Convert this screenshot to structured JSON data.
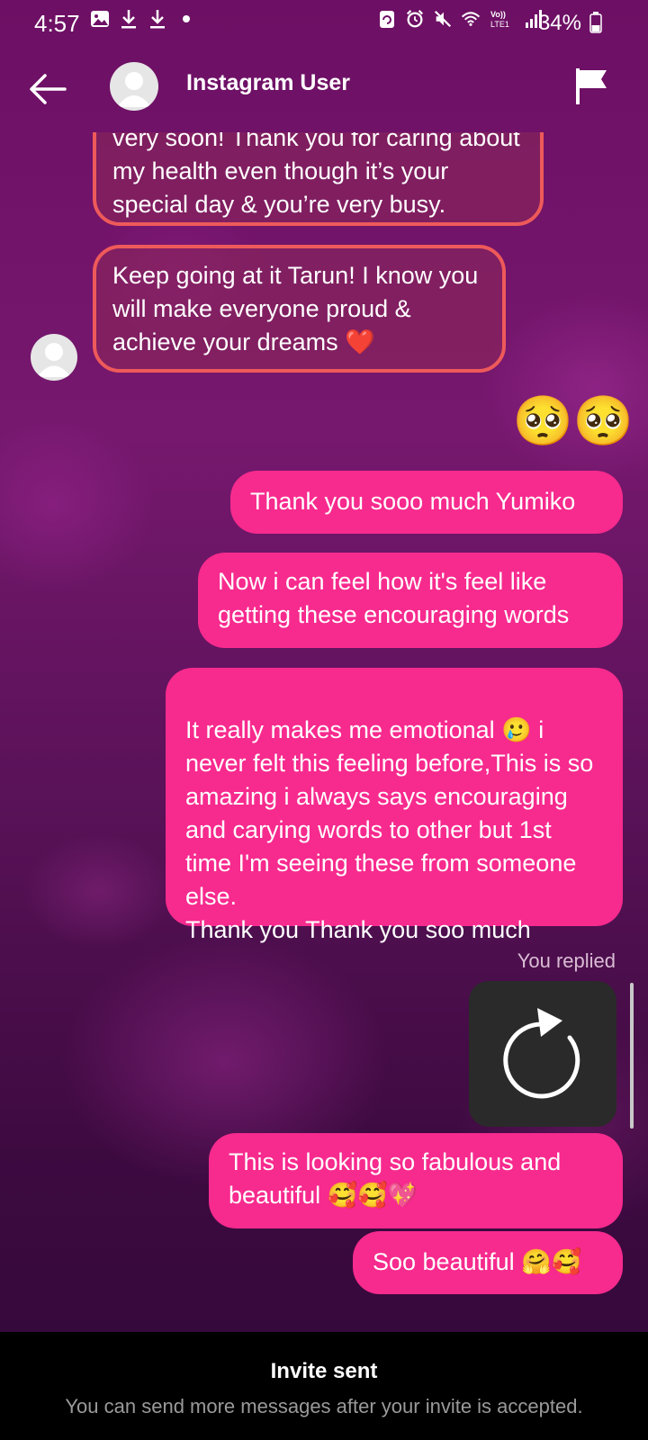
{
  "status_bar": {
    "time": "4:57",
    "battery": "34%",
    "left_icons": [
      "image-icon",
      "download-icon",
      "download-icon",
      "dot-icon"
    ],
    "right_icons": [
      "sync-icon",
      "alarm-icon",
      "mute-icon",
      "wifi-icon",
      "volte-icon",
      "signal-icon",
      "battery-icon"
    ],
    "volte_label": "Vo)) LTE1"
  },
  "header": {
    "user_name": "Instagram User",
    "back_icon": "back-arrow-icon",
    "flag_icon": "flag-icon"
  },
  "messages": {
    "incoming_1": "very soon! Thank you for caring about my health even though it’s your special day & you’re very busy.",
    "incoming_2": "Keep going at it Tarun! I know you will make everyone proud & achieve your dreams ❤️",
    "emoji_reaction": "🥺🥺",
    "out_1": "Thank you sooo much Yumiko",
    "out_2": "Now i can feel how it's feel like getting these encouraging words",
    "out_3": "It really makes me emotional 🥲 i never felt this feeling before,This is so amazing i always says encouraging and carying words to other but 1st time I'm seeing these from someone else.\nThank you Thank you soo much",
    "you_replied": "You replied",
    "out_4": "This is looking so fabulous and beautiful 🥰🥰💖",
    "out_5": "Soo beautiful 🤗🥰"
  },
  "footer": {
    "title": "Invite sent",
    "subtitle": "You can send more messages after your invite is accepted."
  }
}
